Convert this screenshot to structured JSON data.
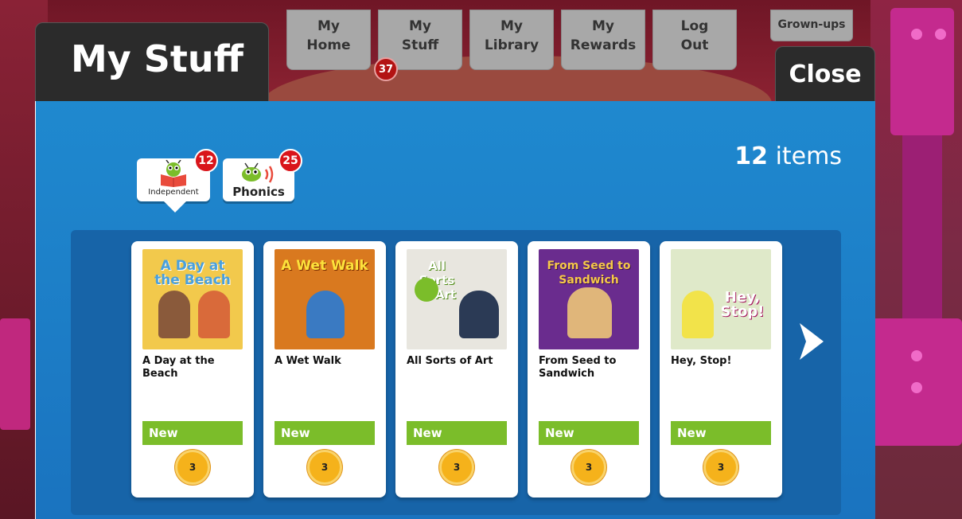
{
  "page_title": "My Stuff",
  "nav": [
    {
      "label": "My\nHome",
      "line1": "My",
      "line2": "Home"
    },
    {
      "label": "My\nStuff",
      "line1": "My",
      "line2": "Stuff"
    },
    {
      "label": "My\nLibrary",
      "line1": "My",
      "line2": "Library"
    },
    {
      "label": "My\nRewards",
      "line1": "My",
      "line2": "Rewards"
    },
    {
      "label": "Log\nOut",
      "line1": "Log",
      "line2": "Out"
    }
  ],
  "nav_badge": "37",
  "grownups_label": "Grown-ups",
  "close_label": "Close",
  "items_count": {
    "number": "12",
    "label": "items"
  },
  "filters": [
    {
      "label": "Independent",
      "badge": "12",
      "selected": true
    },
    {
      "label": "Phonics",
      "badge": "25",
      "selected": false
    }
  ],
  "books": [
    {
      "title": "A Day at the Beach",
      "cover_title": "A Day at the Beach",
      "tag": "New",
      "level": "3",
      "cover_color": "#f2c94c",
      "accent": "#5aa3d6"
    },
    {
      "title": "A Wet Walk",
      "cover_title": "A Wet Walk",
      "tag": "New",
      "level": "3",
      "cover_color": "#d9791f",
      "accent": "#3a7ac2"
    },
    {
      "title": "All Sorts of Art",
      "cover_title": "All Sorts of Art",
      "tag": "New",
      "level": "3",
      "cover_color": "#e8e6df",
      "accent": "#7bbd2a"
    },
    {
      "title": "From Seed to Sandwich",
      "cover_title": "From Seed to Sandwich",
      "tag": "New",
      "level": "3",
      "cover_color": "#6a2c8e",
      "accent": "#e0b67a"
    },
    {
      "title": "Hey, Stop!",
      "cover_title": "Hey, Stop!",
      "tag": "New",
      "level": "3",
      "cover_color": "#dfe9c9",
      "accent": "#d9267e"
    }
  ],
  "colors": {
    "panel_blue": "#1f89cf",
    "shelf_blue": "#1764a8",
    "new_green": "#7bbd2a",
    "badge_red": "#d9151b",
    "level_gold": "#f5b21b"
  }
}
